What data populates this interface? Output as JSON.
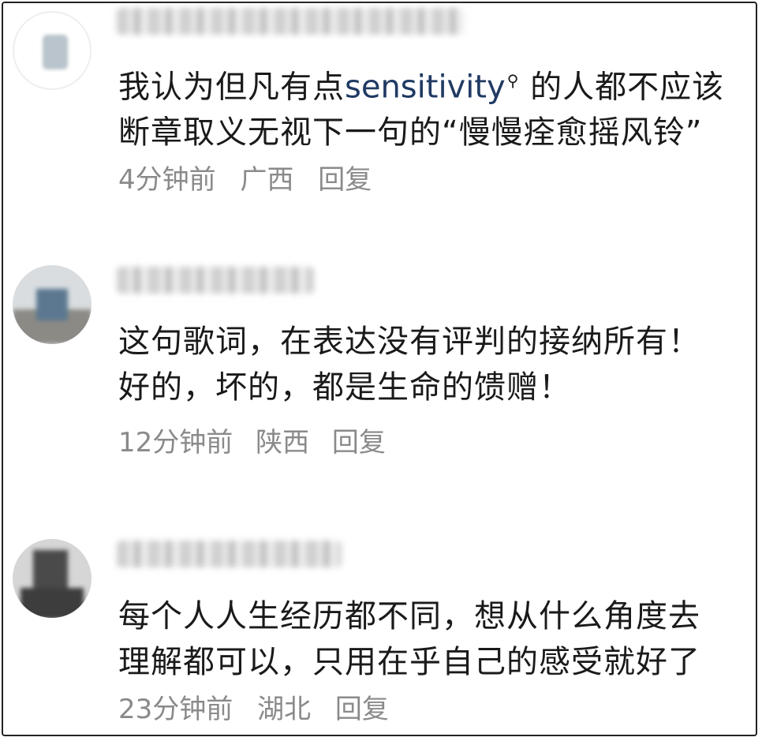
{
  "comments": [
    {
      "text_before": "我认为但凡有点",
      "keyword": "sensitivity",
      "text_after": " 的人都不应该断章取义无视下一句的“慢慢痊愈摇风铃”",
      "time": "4分钟前",
      "location": "广西",
      "reply": "回复"
    },
    {
      "text": "这句歌词，在表达没有评判的接纳所有！好的，坏的，都是生命的馈赠！",
      "time": "12分钟前",
      "location": "陕西",
      "reply": "回复"
    },
    {
      "text": "每个人人生经历都不同，想从什么角度去理解都可以，只用在乎自己的感受就好了",
      "time": "23分钟前",
      "location": "湖北",
      "reply": "回复"
    }
  ]
}
